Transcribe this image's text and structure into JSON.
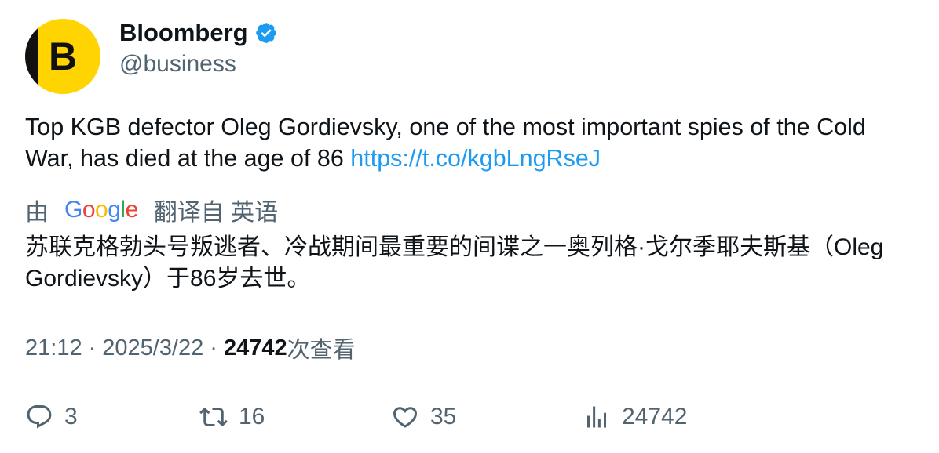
{
  "author": {
    "avatar_letter": "B",
    "display_name": "Bloomberg",
    "handle": "@business",
    "verified": true,
    "avatar_color": "#ffd400"
  },
  "tweet": {
    "text": "Top KGB defector Oleg Gordievsky, one of the most important spies of the Cold War, has died at the age of 86 ",
    "link": "https://t.co/kgbLngRseJ"
  },
  "translation": {
    "prefix": "由",
    "provider_letters": [
      "G",
      "o",
      "o",
      "g",
      "l",
      "e"
    ],
    "suffix": "翻译自 英语",
    "text": "苏联克格勃头号叛逃者、冷战期间最重要的间谍之一奥列格·戈尔季耶夫斯基（Oleg Gordievsky）于86岁去世。"
  },
  "meta": {
    "time": "21:12",
    "separator": "·",
    "date": "2025/3/22",
    "views_count": "24742",
    "views_label": "次查看"
  },
  "actions": {
    "reply_count": "3",
    "retweet_count": "16",
    "like_count": "35",
    "views_count": "24742"
  },
  "colors": {
    "link": "#1d9bf0",
    "secondary_text": "#536471",
    "primary_text": "#0f1419",
    "verified": "#1d9bf0"
  },
  "icons": {
    "reply": "reply-icon",
    "retweet": "retweet-icon",
    "like": "heart-icon",
    "views": "views-chart-icon",
    "verified": "verified-badge-icon"
  }
}
